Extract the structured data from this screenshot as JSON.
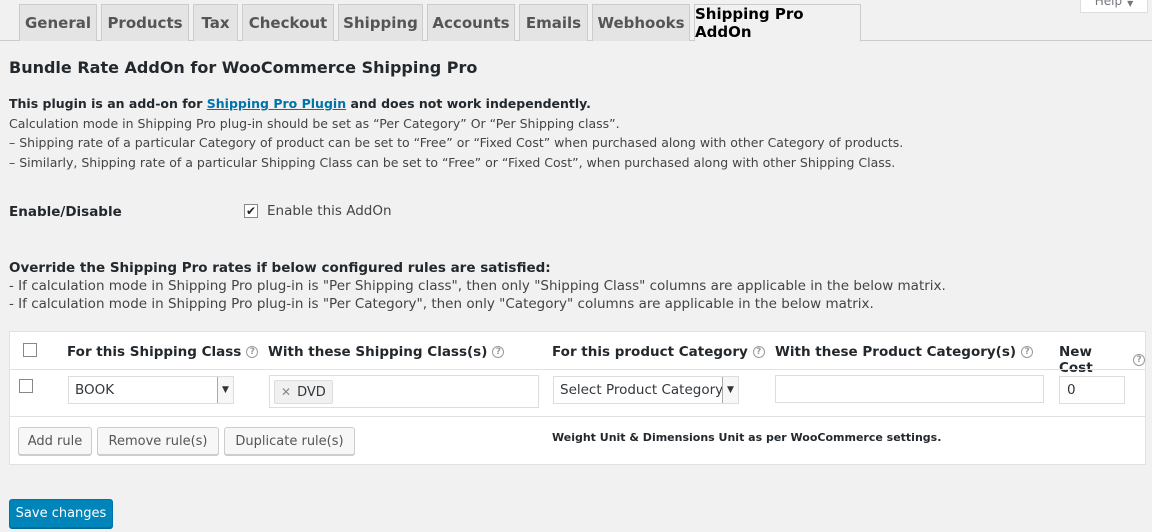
{
  "help": {
    "label": "Help",
    "icon": "triangle-down-icon"
  },
  "tabs": [
    {
      "label": "General"
    },
    {
      "label": "Products"
    },
    {
      "label": "Tax"
    },
    {
      "label": "Checkout"
    },
    {
      "label": "Shipping"
    },
    {
      "label": "Accounts"
    },
    {
      "label": "Emails"
    },
    {
      "label": "Webhooks"
    },
    {
      "label": "Shipping Pro AddOn",
      "active": true
    }
  ],
  "page": {
    "title": "Bundle Rate AddOn for WooCommerce Shipping Pro",
    "intro_pre": "This plugin is an add-on for ",
    "intro_link": "Shipping Pro Plugin",
    "intro_post": " and does not work independently.",
    "desc_lines": [
      "Calculation mode in Shipping Pro plug-in should be set as “Per Category” Or “Per Shipping class”.",
      "– Shipping rate of a particular Category of product can be set to “Free” or “Fixed Cost” when purchased along with other Category of products.",
      "– Similarly, Shipping rate of a particular Shipping Class can be set to “Free” or “Fixed Cost”, when purchased along with other Shipping Class."
    ]
  },
  "enable": {
    "label": "Enable/Disable",
    "checkbox_label": "Enable this AddOn",
    "checked": true
  },
  "override": {
    "heading": "Override the Shipping Pro rates if below configured rules are satisfied:",
    "lines": [
      "- If calculation mode in Shipping Pro plug-in is \"Per Shipping class\", then only \"Shipping Class\" columns are applicable in the below matrix.",
      "- If calculation mode in Shipping Pro plug-in is \"Per Category\", then only \"Category\" columns are applicable in the below matrix."
    ]
  },
  "table": {
    "headers": {
      "shipping_class": "For this Shipping Class",
      "with_shipping_classes": "With these Shipping Class(s)",
      "product_category": "For this product Category",
      "with_product_categories": "With these Product Category(s)",
      "new_cost": "New Cost"
    },
    "row": {
      "checked": false,
      "shipping_class": "BOOK",
      "with_shipping_classes": [
        "DVD"
      ],
      "product_category": "Select Product Category",
      "with_product_categories": "",
      "new_cost": "0"
    },
    "buttons": {
      "add": "Add rule",
      "remove": "Remove rule(s)",
      "duplicate": "Duplicate rule(s)"
    },
    "note": "Weight Unit & Dimensions Unit as per WooCommerce settings."
  },
  "save_label": "Save changes",
  "colors": {
    "primary": "#0085ba",
    "link": "#0073aa",
    "background": "#f1f1f1"
  }
}
